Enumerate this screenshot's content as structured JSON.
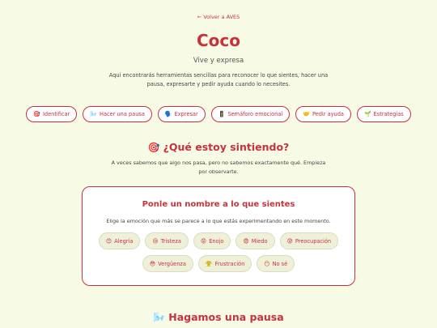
{
  "back_link": "← Volver a AVES",
  "title": "Coco",
  "subtitle": "Vive y expresa",
  "intro": "Aquí encontrarás herramientas sencillas para reconocer lo que sientes, hacer una pausa, expresarte y pedir ayuda cuando lo necesites.",
  "nav": [
    {
      "icon": "🎯",
      "label": "Identificar"
    },
    {
      "icon": "🌬️",
      "label": "Hacer una pausa"
    },
    {
      "icon": "🗣️",
      "label": "Expresar"
    },
    {
      "icon": "🚦",
      "label": "Semáforo emocional"
    },
    {
      "icon": "🤝",
      "label": "Pedir ayuda"
    },
    {
      "icon": "🌱",
      "label": "Estrategias"
    }
  ],
  "section1": {
    "icon": "🎯",
    "title": "¿Qué estoy sintiendo?",
    "description": "A veces sabemos que algo nos pasa, pero no sabemos exactamente qué. Empieza por observarte."
  },
  "card": {
    "title": "Ponle un nombre a lo que sientes",
    "description": "Elige la emoción que más se parece a lo que estás experimentando en este momento.",
    "emotions_row1": [
      {
        "icon": "😊",
        "label": "Alegría"
      },
      {
        "icon": "😢",
        "label": "Tristeza"
      },
      {
        "icon": "😡",
        "label": "Enojo"
      },
      {
        "icon": "😨",
        "label": "Miedo"
      },
      {
        "icon": "😰",
        "label": "Preocupación"
      }
    ],
    "emotions_row2": [
      {
        "icon": "😳",
        "label": "Vergüenza"
      },
      {
        "icon": "😤",
        "label": "Frustración"
      },
      {
        "icon": "😶",
        "label": "No sé"
      }
    ]
  },
  "section2": {
    "icon": "🌬️",
    "title": "Hagamos una pausa"
  }
}
